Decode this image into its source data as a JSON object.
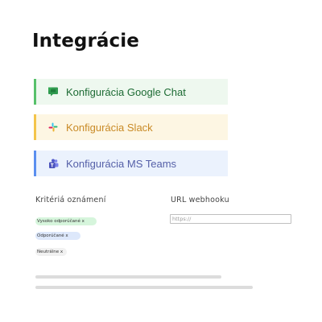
{
  "page": {
    "title": "Integrácie"
  },
  "integrations": [
    {
      "label": "Konfigurácia Google Chat",
      "icon": "google-chat-icon",
      "accent": "#57c16a"
    },
    {
      "label": "Konfigurácia Slack",
      "icon": "slack-icon",
      "accent": "#f3c44a"
    },
    {
      "label": "Konfigurácia MS Teams",
      "icon": "ms-teams-icon",
      "accent": "#5b8ff0"
    }
  ],
  "criteria": {
    "label": "Kritériá oznámení",
    "chips": [
      {
        "label": "Vysoko odporúčané x",
        "color": "#d6f5dc"
      },
      {
        "label": "Odporúčané x",
        "color": "#dde8fb"
      },
      {
        "label": "Neutrálne x",
        "color": "#f1f1f1"
      }
    ]
  },
  "webhook": {
    "label": "URL webhooku",
    "placeholder": "https://"
  }
}
